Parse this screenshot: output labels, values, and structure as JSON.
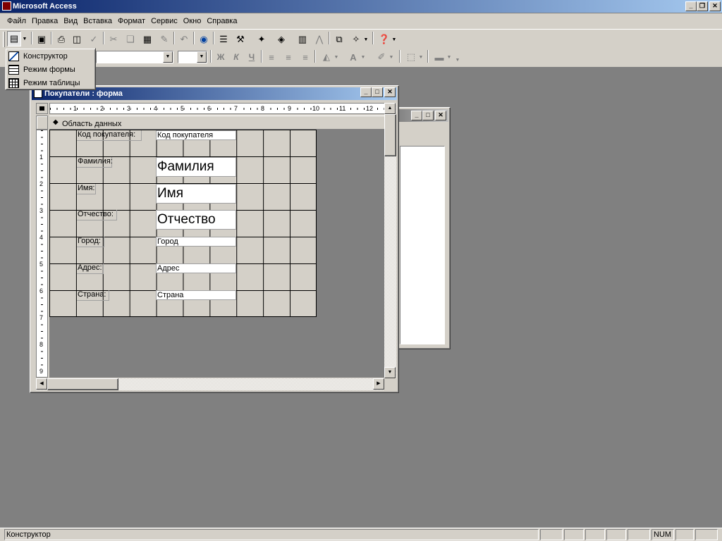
{
  "app": {
    "title": "Microsoft Access"
  },
  "menu": [
    "Файл",
    "Правка",
    "Вид",
    "Вставка",
    "Формат",
    "Сервис",
    "Окно",
    "Справка"
  ],
  "view_menu": {
    "items": [
      "Конструктор",
      "Режим формы",
      "Режим таблицы"
    ]
  },
  "form_window": {
    "title": "Покупатели : форма",
    "section": "Область данных",
    "ruler_top": [
      "1",
      "2",
      "3",
      "4",
      "5",
      "6",
      "7",
      "8",
      "9",
      "10",
      "11",
      "12"
    ],
    "ruler_left": [
      "1",
      "2",
      "3",
      "4",
      "5",
      "6",
      "7",
      "8",
      "9"
    ],
    "fields": [
      {
        "label": "Код покупателя:",
        "control": "Код покупателя"
      },
      {
        "label": "Фамилия:",
        "control": "Фамилия"
      },
      {
        "label": "Имя:",
        "control": "Имя"
      },
      {
        "label": "Отчество:",
        "control": "Отчество"
      },
      {
        "label": "Город:",
        "control": "Город"
      },
      {
        "label": "Адрес:",
        "control": "Адрес"
      },
      {
        "label": "Страна:",
        "control": "Страна"
      }
    ]
  },
  "formatting": {
    "bold": "Ж",
    "italic": "К",
    "underline": "Ч"
  },
  "status": {
    "text": "Конструктор",
    "num": "NUM"
  },
  "colors": {
    "title_active": "#0a246a",
    "title_gradient_end": "#a6caf0",
    "face": "#d4d0c8",
    "workspace": "#808080"
  },
  "icons": [
    "view-icon",
    "save-icon",
    "print-icon",
    "print-preview-icon",
    "spelling-icon",
    "cut-icon",
    "copy-icon",
    "paste-icon",
    "format-painter-icon",
    "undo-icon",
    "hyperlink-icon",
    "field-list-icon",
    "toolbox-icon",
    "autoformat-icon",
    "code-icon",
    "properties-icon",
    "build-icon",
    "database-window-icon",
    "new-object-icon",
    "help-icon",
    "fill-color-icon",
    "font-color-icon",
    "line-color-icon"
  ]
}
